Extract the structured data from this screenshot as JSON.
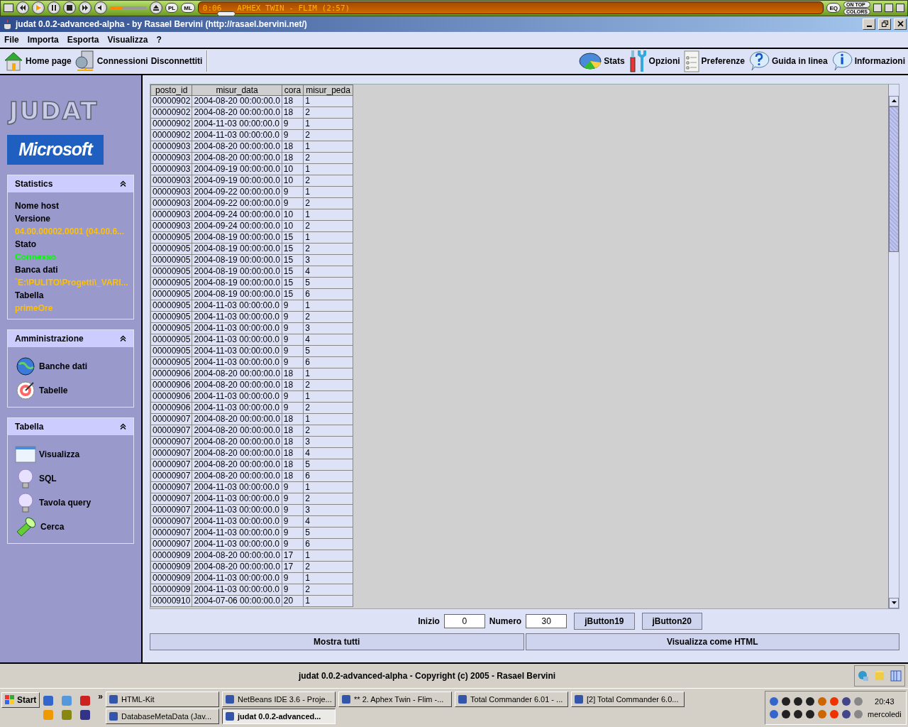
{
  "player": {
    "time": "0:06",
    "track": "APHEX TWIN - FLIM (2:57)",
    "buttons": [
      "PL",
      "ML"
    ],
    "eq": "EQ",
    "on_top": "ON TOP",
    "colors": "COLORS",
    "volume": {
      "level": 0.35
    },
    "seek": {
      "level": 0.03
    }
  },
  "window": {
    "title": "judat 0.0.2-advanced-alpha - by Rasael Bervini (http://rasael.bervini.net/)"
  },
  "menu": [
    "File",
    "Importa",
    "Esporta",
    "Visualizza",
    "?"
  ],
  "toolbar": {
    "left": [
      {
        "label": "Home page",
        "kind": "home"
      },
      {
        "label": "Connessioni",
        "kind": "server"
      },
      {
        "label": "Disconnettiti",
        "kind": "none"
      }
    ],
    "right": [
      {
        "label": "Stats",
        "kind": "chart"
      },
      {
        "label": "Opzioni",
        "kind": "tools"
      },
      {
        "label": "Preferenze",
        "kind": "notepad"
      },
      {
        "label": "Guida in linea",
        "kind": "help"
      },
      {
        "label": "Informazioni",
        "kind": "info"
      }
    ]
  },
  "sidebar": {
    "logo": "JUDAT",
    "vendor": "Microsoft",
    "panels": [
      {
        "title": "Statistics",
        "expanded": true,
        "kind": "stats",
        "fields": [
          {
            "label": "Nome host"
          },
          {
            "label": "Versione",
            "value": "04.00.00002.0001 (04.00.6...",
            "color": "#ffc000"
          },
          {
            "label": "Stato",
            "value": "Connesso",
            "color": "#00ff00"
          },
          {
            "label": "Banca dati",
            "value": "`E:\\PULITO\\Progetti\\_VARI...",
            "color": "#ffc000"
          },
          {
            "label": "Tabella",
            "value": "primeOre",
            "color": "#ffc000"
          }
        ]
      },
      {
        "title": "Amministrazione",
        "expanded": true,
        "kind": "links",
        "items": [
          {
            "label": "Banche dati",
            "kind": "globe"
          },
          {
            "label": "Tabelle",
            "kind": "target"
          }
        ]
      },
      {
        "title": "Tabella",
        "expanded": true,
        "kind": "links",
        "items": [
          {
            "label": "Visualizza",
            "kind": "window"
          },
          {
            "label": "SQL",
            "kind": "bulb"
          },
          {
            "label": "Tavola query",
            "kind": "bulb"
          },
          {
            "label": "Cerca",
            "kind": "flashlight"
          }
        ]
      }
    ]
  },
  "table": {
    "columns": [
      "posto_id",
      "misur_data",
      "cora",
      "misur_peda"
    ],
    "rows": [
      [
        "00000902",
        "2004-08-20 00:00:00.0",
        "18",
        "1"
      ],
      [
        "00000902",
        "2004-08-20 00:00:00.0",
        "18",
        "2"
      ],
      [
        "00000902",
        "2004-11-03 00:00:00.0",
        "9",
        "1"
      ],
      [
        "00000902",
        "2004-11-03 00:00:00.0",
        "9",
        "2"
      ],
      [
        "00000903",
        "2004-08-20 00:00:00.0",
        "18",
        "1"
      ],
      [
        "00000903",
        "2004-08-20 00:00:00.0",
        "18",
        "2"
      ],
      [
        "00000903",
        "2004-09-19 00:00:00.0",
        "10",
        "1"
      ],
      [
        "00000903",
        "2004-09-19 00:00:00.0",
        "10",
        "2"
      ],
      [
        "00000903",
        "2004-09-22 00:00:00.0",
        "9",
        "1"
      ],
      [
        "00000903",
        "2004-09-22 00:00:00.0",
        "9",
        "2"
      ],
      [
        "00000903",
        "2004-09-24 00:00:00.0",
        "10",
        "1"
      ],
      [
        "00000903",
        "2004-09-24 00:00:00.0",
        "10",
        "2"
      ],
      [
        "00000905",
        "2004-08-19 00:00:00.0",
        "15",
        "1"
      ],
      [
        "00000905",
        "2004-08-19 00:00:00.0",
        "15",
        "2"
      ],
      [
        "00000905",
        "2004-08-19 00:00:00.0",
        "15",
        "3"
      ],
      [
        "00000905",
        "2004-08-19 00:00:00.0",
        "15",
        "4"
      ],
      [
        "00000905",
        "2004-08-19 00:00:00.0",
        "15",
        "5"
      ],
      [
        "00000905",
        "2004-08-19 00:00:00.0",
        "15",
        "6"
      ],
      [
        "00000905",
        "2004-11-03 00:00:00.0",
        "9",
        "1"
      ],
      [
        "00000905",
        "2004-11-03 00:00:00.0",
        "9",
        "2"
      ],
      [
        "00000905",
        "2004-11-03 00:00:00.0",
        "9",
        "3"
      ],
      [
        "00000905",
        "2004-11-03 00:00:00.0",
        "9",
        "4"
      ],
      [
        "00000905",
        "2004-11-03 00:00:00.0",
        "9",
        "5"
      ],
      [
        "00000905",
        "2004-11-03 00:00:00.0",
        "9",
        "6"
      ],
      [
        "00000906",
        "2004-08-20 00:00:00.0",
        "18",
        "1"
      ],
      [
        "00000906",
        "2004-08-20 00:00:00.0",
        "18",
        "2"
      ],
      [
        "00000906",
        "2004-11-03 00:00:00.0",
        "9",
        "1"
      ],
      [
        "00000906",
        "2004-11-03 00:00:00.0",
        "9",
        "2"
      ],
      [
        "00000907",
        "2004-08-20 00:00:00.0",
        "18",
        "1"
      ],
      [
        "00000907",
        "2004-08-20 00:00:00.0",
        "18",
        "2"
      ],
      [
        "00000907",
        "2004-08-20 00:00:00.0",
        "18",
        "3"
      ],
      [
        "00000907",
        "2004-08-20 00:00:00.0",
        "18",
        "4"
      ],
      [
        "00000907",
        "2004-08-20 00:00:00.0",
        "18",
        "5"
      ],
      [
        "00000907",
        "2004-08-20 00:00:00.0",
        "18",
        "6"
      ],
      [
        "00000907",
        "2004-11-03 00:00:00.0",
        "9",
        "1"
      ],
      [
        "00000907",
        "2004-11-03 00:00:00.0",
        "9",
        "2"
      ],
      [
        "00000907",
        "2004-11-03 00:00:00.0",
        "9",
        "3"
      ],
      [
        "00000907",
        "2004-11-03 00:00:00.0",
        "9",
        "4"
      ],
      [
        "00000907",
        "2004-11-03 00:00:00.0",
        "9",
        "5"
      ],
      [
        "00000907",
        "2004-11-03 00:00:00.0",
        "9",
        "6"
      ],
      [
        "00000909",
        "2004-08-20 00:00:00.0",
        "17",
        "1"
      ],
      [
        "00000909",
        "2004-08-20 00:00:00.0",
        "17",
        "2"
      ],
      [
        "00000909",
        "2004-11-03 00:00:00.0",
        "9",
        "1"
      ],
      [
        "00000909",
        "2004-11-03 00:00:00.0",
        "9",
        "2"
      ],
      [
        "00000910",
        "2004-07-06 00:00:00.0",
        "20",
        "1"
      ]
    ]
  },
  "controls": {
    "inizio": {
      "label": "Inizio",
      "value": "0"
    },
    "numero": {
      "label": "Numero",
      "value": "30"
    },
    "buttons": [
      "jButton19",
      "jButton20"
    ]
  },
  "actions": [
    "Mostra tutti",
    "Visualizza come HTML"
  ],
  "status_bar": {
    "text": "judat 0.0.2-advanced-alpha - Copyright (c) 2005 - Rasael Bervini"
  },
  "taskbar": {
    "start": "Start",
    "more": "»",
    "task_rows": [
      [
        {
          "label": "HTML-Kit",
          "selected": false
        },
        {
          "label": "NetBeans IDE 3.6 - Proje...",
          "selected": false
        },
        {
          "label": "** 2. Aphex Twin - Flim -...",
          "selected": false
        },
        {
          "label": "Total Commander 6.01 - ...",
          "selected": false
        },
        {
          "label": "[2] Total Commander 6.0...",
          "selected": false
        }
      ],
      [
        {
          "label": "DatabaseMetaData (Jav...",
          "selected": false
        },
        {
          "label": "judat 0.0.2-advanced...",
          "selected": true
        }
      ]
    ],
    "clock": "20:43",
    "day": "mercoledi"
  }
}
